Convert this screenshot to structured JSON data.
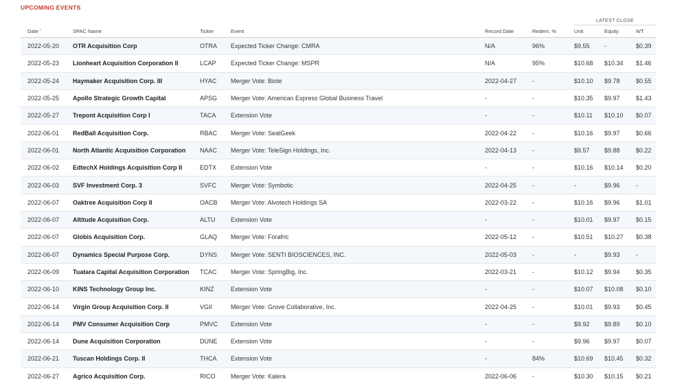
{
  "section_title": "UPCOMING EVENTS",
  "latest_close_label": "LATEST CLOSE",
  "columns": {
    "date": "Date",
    "spac_name": "SPAC Name",
    "ticker": "Ticker",
    "event": "Event",
    "record_date": "Record Date",
    "redem": "Redem. %",
    "unit": "Unit",
    "equity": "Equity",
    "wt": "WT"
  },
  "sort_icon": "↑",
  "rows": [
    [
      "2022-05-20",
      "OTR Acquisition Corp",
      "OTRA",
      "Expected Ticker Change: CMRA",
      "N/A",
      "96%",
      "$9.55",
      "-",
      "$0.39"
    ],
    [
      "2022-05-23",
      "Lionheart Acquisition Corporation II",
      "LCAP",
      "Expected Ticker Change: MSPR",
      "N/A",
      "95%",
      "$10.68",
      "$10.34",
      "$1.46"
    ],
    [
      "2022-05-24",
      "Haymaker Acquisition Corp. III",
      "HYAC",
      "Merger Vote: Biote",
      "2022-04-27",
      "-",
      "$10.10",
      "$9.78",
      "$0.55"
    ],
    [
      "2022-05-25",
      "Apollo Strategic Growth Capital",
      "APSG",
      "Merger Vote: American Express Global Business Travel",
      "-",
      "-",
      "$10.35",
      "$9.97",
      "$1.43"
    ],
    [
      "2022-05-27",
      "Trepont Acquisition Corp I",
      "TACA",
      "Extension Vote",
      "-",
      "-",
      "$10.11",
      "$10.10",
      "$0.07"
    ],
    [
      "2022-06-01",
      "RedBall Acquisition Corp.",
      "RBAC",
      "Merger Vote: SeatGeek",
      "2022-04-22",
      "-",
      "$10.16",
      "$9.97",
      "$0.66"
    ],
    [
      "2022-06-01",
      "North Atlantic Acquisition Corporation",
      "NAAC",
      "Merger Vote: TeleSign Holdings, Inc.",
      "2022-04-13",
      "-",
      "$9.57",
      "$9.88",
      "$0.22"
    ],
    [
      "2022-06-02",
      "EdtechX Holdings Acquisition Corp II",
      "EDTX",
      "Extension Vote",
      "-",
      "-",
      "$10.16",
      "$10.14",
      "$0.20"
    ],
    [
      "2022-06-03",
      "SVF Investment Corp. 3",
      "SVFC",
      "Merger Vote: Symbotic",
      "2022-04-25",
      "-",
      "-",
      "$9.96",
      "-"
    ],
    [
      "2022-06-07",
      "Oaktree Acquisition Corp II",
      "OACB",
      "Merger Vote: Alvotech Holdings SA",
      "2022-03-22",
      "-",
      "$10.16",
      "$9.96",
      "$1.01"
    ],
    [
      "2022-06-07",
      "Altitude Acquisition Corp.",
      "ALTU",
      "Extension Vote",
      "-",
      "-",
      "$10.01",
      "$9.97",
      "$0.15"
    ],
    [
      "2022-06-07",
      "Globis Acquisition Corp.",
      "GLAQ",
      "Merger Vote: Forafric",
      "2022-05-12",
      "-",
      "$10.51",
      "$10.27",
      "$0.38"
    ],
    [
      "2022-06-07",
      "Dynamics Special Purpose Corp.",
      "DYNS",
      "Merger Vote: SENTI BIOSCIENCES, INC.",
      "2022-05-03",
      "-",
      "-",
      "$9.93",
      "-"
    ],
    [
      "2022-06-09",
      "Tuatara Capital Acquisition Corporation",
      "TCAC",
      "Merger Vote: SpringBig, Inc.",
      "2022-03-21",
      "-",
      "$10.12",
      "$9.94",
      "$0.35"
    ],
    [
      "2022-06-10",
      "KINS Technology Group Inc.",
      "KINZ",
      "Extension Vote",
      "-",
      "-",
      "$10.07",
      "$10.08",
      "$0.10"
    ],
    [
      "2022-06-14",
      "Virgin Group Acquisition Corp. II",
      "VGII",
      "Merger Vote: Grove Collaborative, Inc.",
      "2022-04-25",
      "-",
      "$10.01",
      "$9.93",
      "$0.45"
    ],
    [
      "2022-06-14",
      "PMV Consumer Acquisition Corp",
      "PMVC",
      "Extension Vote",
      "-",
      "-",
      "$9.92",
      "$9.89",
      "$0.10"
    ],
    [
      "2022-06-14",
      "Dune Acquisition Corporation",
      "DUNE",
      "Extension Vote",
      "-",
      "-",
      "$9.96",
      "$9.97",
      "$0.07"
    ],
    [
      "2022-06-21",
      "Tuscan Holdings Corp. II",
      "THCA",
      "Extension Vote",
      "-",
      "84%",
      "$10.69",
      "$10.45",
      "$0.32"
    ],
    [
      "2022-06-27",
      "Agrico Acquisition Corp.",
      "RICO",
      "Merger Vote: Kalera",
      "2022-06-06",
      "-",
      "$10.30",
      "$10.15",
      "$0.21"
    ]
  ]
}
